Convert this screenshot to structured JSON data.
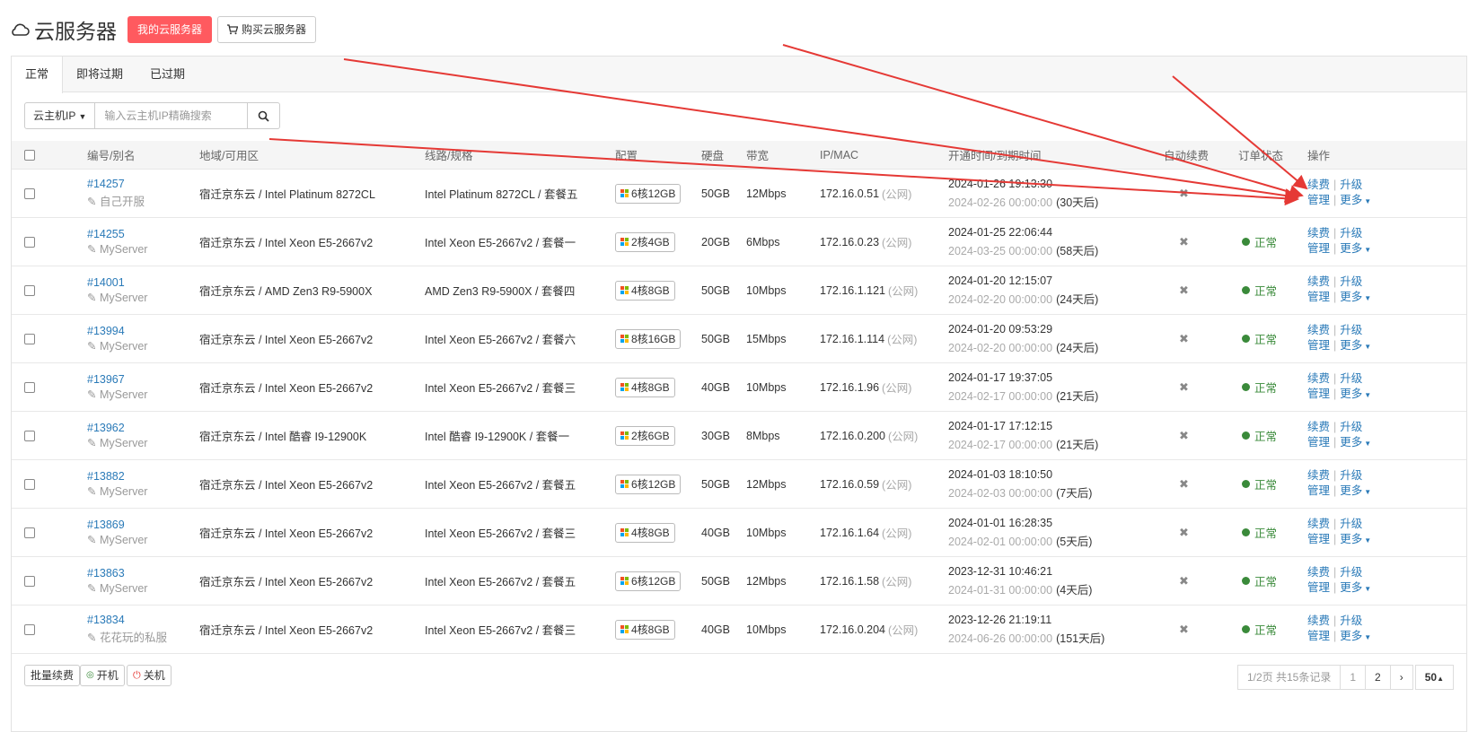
{
  "header": {
    "title": "云服务器",
    "my_servers_label": "我的云服务器",
    "buy_label": "购买云服务器"
  },
  "tabs": [
    {
      "label": "正常"
    },
    {
      "label": "即将过期"
    },
    {
      "label": "已过期"
    }
  ],
  "search": {
    "type_label": "云主机IP",
    "placeholder": "输入云主机IP精确搜索"
  },
  "columns": {
    "id": "编号/别名",
    "region": "地域/可用区",
    "line": "线路/规格",
    "config": "配置",
    "disk": "硬盘",
    "bandwidth": "带宽",
    "ipmac": "IP/MAC",
    "time": "开通时间/到期时间",
    "autorenew": "自动续费",
    "status": "订单状态",
    "actions": "操作"
  },
  "row_labels": {
    "public": "(公网)",
    "status_normal": "正常",
    "renew": "续费",
    "upgrade": "升级",
    "manage": "管理",
    "more": "更多"
  },
  "rows": [
    {
      "id": "#14257",
      "alias": "自己开服",
      "region": "宿迁京东云 / Intel Platinum 8272CL",
      "line": "Intel Platinum 8272CL / 套餐五",
      "config": "6核12GB",
      "disk": "50GB",
      "bw": "12Mbps",
      "ip": "172.16.0.51",
      "start": "2024-01-26 19:13:30",
      "end": "2024-02-26 00:00:00",
      "left": "(30天后)",
      "status": ""
    },
    {
      "id": "#14255",
      "alias": "MyServer",
      "region": "宿迁京东云 / Intel Xeon E5-2667v2",
      "line": "Intel Xeon E5-2667v2 / 套餐一",
      "config": "2核4GB",
      "disk": "20GB",
      "bw": "6Mbps",
      "ip": "172.16.0.23",
      "start": "2024-01-25 22:06:44",
      "end": "2024-03-25 00:00:00",
      "left": "(58天后)",
      "status": "正常"
    },
    {
      "id": "#14001",
      "alias": "MyServer",
      "region": "宿迁京东云 / AMD Zen3 R9-5900X",
      "line": "AMD Zen3 R9-5900X / 套餐四",
      "config": "4核8GB",
      "disk": "50GB",
      "bw": "10Mbps",
      "ip": "172.16.1.121",
      "start": "2024-01-20 12:15:07",
      "end": "2024-02-20 00:00:00",
      "left": "(24天后)",
      "status": "正常"
    },
    {
      "id": "#13994",
      "alias": "MyServer",
      "region": "宿迁京东云 / Intel Xeon E5-2667v2",
      "line": "Intel Xeon E5-2667v2 / 套餐六",
      "config": "8核16GB",
      "disk": "50GB",
      "bw": "15Mbps",
      "ip": "172.16.1.114",
      "start": "2024-01-20 09:53:29",
      "end": "2024-02-20 00:00:00",
      "left": "(24天后)",
      "status": "正常"
    },
    {
      "id": "#13967",
      "alias": "MyServer",
      "region": "宿迁京东云 / Intel Xeon E5-2667v2",
      "line": "Intel Xeon E5-2667v2 / 套餐三",
      "config": "4核8GB",
      "disk": "40GB",
      "bw": "10Mbps",
      "ip": "172.16.1.96",
      "start": "2024-01-17 19:37:05",
      "end": "2024-02-17 00:00:00",
      "left": "(21天后)",
      "status": "正常"
    },
    {
      "id": "#13962",
      "alias": "MyServer",
      "region": "宿迁京东云 / Intel 酷睿 I9-12900K",
      "line": "Intel 酷睿 I9-12900K / 套餐一",
      "config": "2核6GB",
      "disk": "30GB",
      "bw": "8Mbps",
      "ip": "172.16.0.200",
      "start": "2024-01-17 17:12:15",
      "end": "2024-02-17 00:00:00",
      "left": "(21天后)",
      "status": "正常"
    },
    {
      "id": "#13882",
      "alias": "MyServer",
      "region": "宿迁京东云 / Intel Xeon E5-2667v2",
      "line": "Intel Xeon E5-2667v2 / 套餐五",
      "config": "6核12GB",
      "disk": "50GB",
      "bw": "12Mbps",
      "ip": "172.16.0.59",
      "start": "2024-01-03 18:10:50",
      "end": "2024-02-03 00:00:00",
      "left": "(7天后)",
      "status": "正常"
    },
    {
      "id": "#13869",
      "alias": "MyServer",
      "region": "宿迁京东云 / Intel Xeon E5-2667v2",
      "line": "Intel Xeon E5-2667v2 / 套餐三",
      "config": "4核8GB",
      "disk": "40GB",
      "bw": "10Mbps",
      "ip": "172.16.1.64",
      "start": "2024-01-01 16:28:35",
      "end": "2024-02-01 00:00:00",
      "left": "(5天后)",
      "status": "正常"
    },
    {
      "id": "#13863",
      "alias": "MyServer",
      "region": "宿迁京东云 / Intel Xeon E5-2667v2",
      "line": "Intel Xeon E5-2667v2 / 套餐五",
      "config": "6核12GB",
      "disk": "50GB",
      "bw": "12Mbps",
      "ip": "172.16.1.58",
      "start": "2023-12-31 10:46:21",
      "end": "2024-01-31 00:00:00",
      "left": "(4天后)",
      "status": "正常"
    },
    {
      "id": "#13834",
      "alias": "花花玩的私服",
      "region": "宿迁京东云 / Intel Xeon E5-2667v2",
      "line": "Intel Xeon E5-2667v2 / 套餐三",
      "config": "4核8GB",
      "disk": "40GB",
      "bw": "10Mbps",
      "ip": "172.16.0.204",
      "start": "2023-12-26 21:19:11",
      "end": "2024-06-26 00:00:00",
      "left": "(151天后)",
      "status": "正常"
    }
  ],
  "footer": {
    "batch_renew": "批量续费",
    "power_on": "开机",
    "power_off": "关机",
    "page_info": "1/2页 共15条记录",
    "page1": "1",
    "page2": "2",
    "next": "›",
    "page_size": "50"
  },
  "colors": {
    "accent": "#ff5a5f",
    "link": "#2a7ab8",
    "ok": "#3a8a3a",
    "annotation_arrow": "#e53935"
  }
}
